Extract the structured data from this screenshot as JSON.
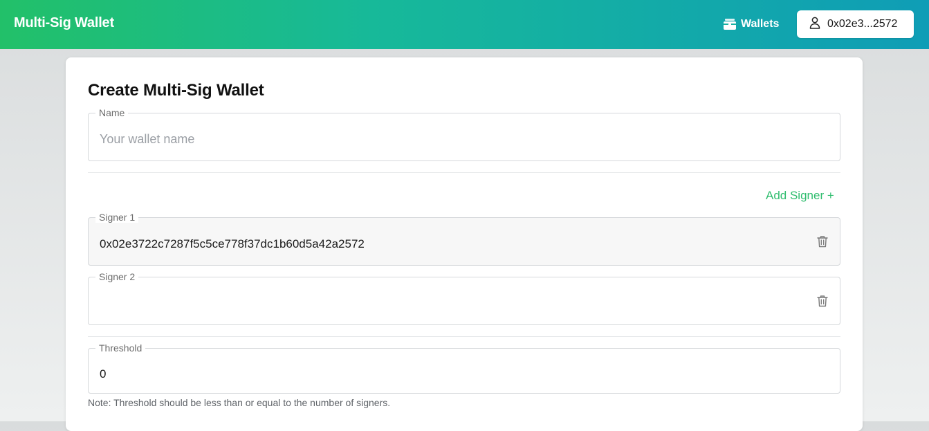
{
  "header": {
    "app_title": "Multi-Sig Wallet",
    "wallets_label": "Wallets",
    "wallets_icon": "wallet-icon",
    "account_label": "0x02e3...2572",
    "account_icon": "user-icon",
    "gradient_colors": [
      "#22c069",
      "#17b999",
      "#0f9db6"
    ]
  },
  "form": {
    "title": "Create Multi-Sig Wallet",
    "name_field": {
      "label": "Name",
      "placeholder": "Your wallet name",
      "value": ""
    },
    "add_signer_label": "Add Signer +",
    "accent_color": "#2fbd6e",
    "signers": [
      {
        "label": "Signer 1",
        "value": "0x02e3722c7287f5c5ce778f37dc1b60d5a42a2572",
        "delete_icon": "trash-icon"
      },
      {
        "label": "Signer 2",
        "value": "",
        "delete_icon": "trash-icon"
      }
    ],
    "threshold_field": {
      "label": "Threshold",
      "value": "0"
    },
    "note": "Note: Threshold should be less than or equal to the number of signers."
  }
}
